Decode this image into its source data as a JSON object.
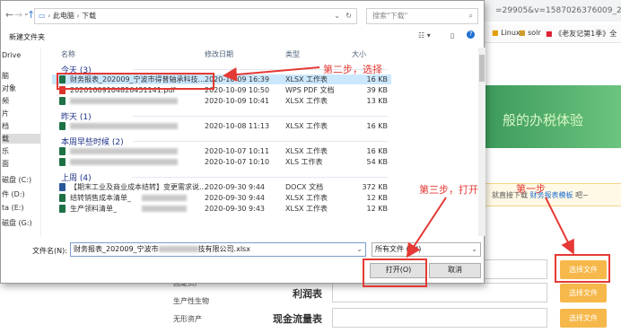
{
  "browser": {
    "url_tail": "=29905&v=1587026376009_2.0.08",
    "bookmarks": [
      {
        "label": "Linux",
        "color": "#e2a000"
      },
      {
        "label": "solr",
        "color": "#d09a2a"
      },
      {
        "label": "《老友记第1季》全",
        "color": "#d23"
      }
    ],
    "banner_text": "般的办税体验",
    "hint_prefix": "就直接下载",
    "hint_link": "财务报表模板",
    "hint_suffix": "吧~",
    "form": {
      "rows": [
        {
          "label": "",
          "button": "选择文件"
        },
        {
          "label": "利润表",
          "button": "选择文件"
        },
        {
          "label": "现金流量表",
          "button": "选择文件"
        }
      ],
      "side_labels": [
        "固定资产",
        "生产性生物",
        "无形资产"
      ]
    }
  },
  "dialog": {
    "breadcrumb": {
      "root": "此电脑",
      "folder": "下载"
    },
    "search_placeholder": "搜索\"下载\"",
    "new_folder_label": "新建文件夹",
    "tree_items": [
      "Drive",
      "脑",
      "对象",
      "频",
      "片",
      "档",
      "载",
      "乐",
      "面",
      "磁盘 (C:)",
      "件 (D:)",
      "ta (E:)",
      "磁盘 (G:)"
    ],
    "columns": {
      "name": "名称",
      "date": "修改日期",
      "type": "类型",
      "size": "大小"
    },
    "groups": [
      {
        "title": "今天 (3)",
        "files": [
          {
            "name": "财务报表_202009_宁波市得普轴承科技...",
            "date": "2020-10-09 16:39",
            "type": "XLSX 工作表",
            "size": "16 KB",
            "icon": "xlsx",
            "selected": true,
            "blur": false
          },
          {
            "name": "20201009104826451141.pdf",
            "date": "2020-10-09 10:50",
            "type": "WPS PDF 文档",
            "size": "39 KB",
            "icon": "pdf",
            "selected": false,
            "blur": false
          },
          {
            "name": "",
            "date": "2020-10-09 10:41",
            "type": "XLSX 工作表",
            "size": "13 KB",
            "icon": "xlsx",
            "selected": false,
            "blur": true
          }
        ]
      },
      {
        "title": "昨天 (1)",
        "files": [
          {
            "name": "",
            "date": "2020-10-08 11:13",
            "type": "XLSX 工作表",
            "size": "16 KB",
            "icon": "xlsx",
            "selected": false,
            "blur": true
          }
        ]
      },
      {
        "title": "本周早些时候 (2)",
        "files": [
          {
            "name": "",
            "date": "2020-10-07 10:11",
            "type": "XLSX 工作表",
            "size": "16 KB",
            "icon": "xlsx",
            "selected": false,
            "blur": true
          },
          {
            "name": "",
            "date": "2020-10-07 10:10",
            "type": "XLS 工作表",
            "size": "54 KB",
            "icon": "xlsx",
            "selected": false,
            "blur": true
          }
        ]
      },
      {
        "title": "上周 (4)",
        "files": [
          {
            "name": "【期末工业及商业成本结转】变更需求说...",
            "date": "2020-09-30 9:44",
            "type": "DOCX 文档",
            "size": "372 KB",
            "icon": "docx",
            "selected": false,
            "blur": false
          },
          {
            "name": "结转销售成本清单_",
            "date": "2020-09-30 9:44",
            "type": "XLSX 工作表",
            "size": "12 KB",
            "icon": "xlsx",
            "selected": false,
            "blur": false
          },
          {
            "name": "生产领料清单_",
            "date": "2020-09-30 9:43",
            "type": "XLSX 工作表",
            "size": "12 KB",
            "icon": "xlsx",
            "selected": false,
            "blur": false
          }
        ]
      }
    ],
    "filename_label": "文件名(N):",
    "filename_prefix": "财务报表_202009_宁波市",
    "filename_suffix": "技有限公司.xlsx",
    "filter_value": "所有文件 (*.*)",
    "open_button": "打开(O)",
    "cancel_button": "取消"
  },
  "annotations": {
    "step1": "第一步",
    "step2": "第二步，选择",
    "step3": "第三步，打开"
  },
  "colors": {
    "accent_red": "#e53935",
    "pick_button": "#f6b84a",
    "selection": "#cce8ff",
    "xlsx_icon": "#1e7145",
    "pdf_icon": "#d9342b",
    "docx_icon": "#2b579a"
  }
}
